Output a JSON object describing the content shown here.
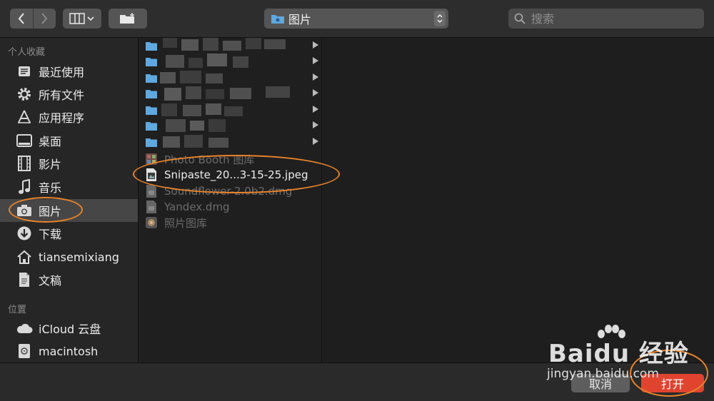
{
  "toolbar": {
    "back_icon": "chevron-left-icon",
    "forward_icon": "chevron-right-icon",
    "view_icon": "column-view-icon",
    "new_folder_icon": "new-folder-icon",
    "path_label": "图片",
    "search_placeholder": "搜索"
  },
  "sidebar": {
    "favorites_title": "个人收藏",
    "locations_title": "位置",
    "favorites": [
      {
        "label": "最近使用",
        "icon": "recents-icon"
      },
      {
        "label": "所有文件",
        "icon": "gear-icon"
      },
      {
        "label": "应用程序",
        "icon": "applications-icon"
      },
      {
        "label": "桌面",
        "icon": "desktop-icon"
      },
      {
        "label": "影片",
        "icon": "film-icon"
      },
      {
        "label": "音乐",
        "icon": "music-note-icon"
      },
      {
        "label": "图片",
        "icon": "camera-icon",
        "selected": true
      },
      {
        "label": "下载",
        "icon": "download-icon"
      },
      {
        "label": "tiansemixiang",
        "icon": "home-icon"
      },
      {
        "label": "文稿",
        "icon": "document-icon"
      }
    ],
    "locations": [
      {
        "label": "iCloud 云盘",
        "icon": "cloud-icon"
      },
      {
        "label": "macintosh",
        "icon": "disk-icon"
      }
    ]
  },
  "files": [
    {
      "name": "Photo Booth 图库",
      "icon": "photo-booth-icon",
      "enabled": false
    },
    {
      "name": "Snipaste_20...3-15-25.jpeg",
      "icon": "image-file-icon",
      "enabled": true
    },
    {
      "name": "Soundflower-2.0b2.dmg",
      "icon": "dmg-file-icon",
      "enabled": false
    },
    {
      "name": "Yandex.dmg",
      "icon": "dmg-file-icon",
      "enabled": false
    },
    {
      "name": "照片图库",
      "icon": "photos-library-icon",
      "enabled": false
    }
  ],
  "buttons": {
    "cancel": "取消",
    "open": "打开"
  },
  "watermark": {
    "brand": "Baidu 经验",
    "url": "jingyan.baidu.com"
  },
  "colors": {
    "accent_open": "#e0442f",
    "annotation": "#e8832a",
    "folder": "#5fa8e0"
  }
}
